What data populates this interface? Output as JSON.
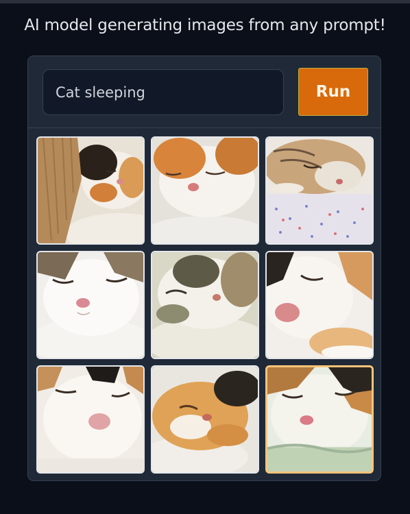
{
  "header": {
    "title": "AI model generating images from any prompt!"
  },
  "prompt": {
    "value": "Cat sleeping"
  },
  "run_button": {
    "label": "Run"
  },
  "colors": {
    "background": "#0b0f19",
    "panel": "#1f2937",
    "accent": "#d86a0b",
    "selected_border": "#f9c47a"
  },
  "gallery": {
    "images": [
      {
        "alt": "calico kitten sleeping under a blanket",
        "selected": false
      },
      {
        "alt": "orange and white cat sleeping",
        "selected": false
      },
      {
        "alt": "tabby cat sleeping on a speckled blanket",
        "selected": false
      },
      {
        "alt": "white and tabby cat sleeping close-up",
        "selected": false
      },
      {
        "alt": "white and tabby cat curled up sleeping",
        "selected": false
      },
      {
        "alt": "calico cat nose close-up sleeping",
        "selected": false
      },
      {
        "alt": "white cat with black patch sleeping",
        "selected": false
      },
      {
        "alt": "orange cat curled up sleeping",
        "selected": false
      },
      {
        "alt": "calico cat face sleeping",
        "selected": true
      }
    ]
  }
}
